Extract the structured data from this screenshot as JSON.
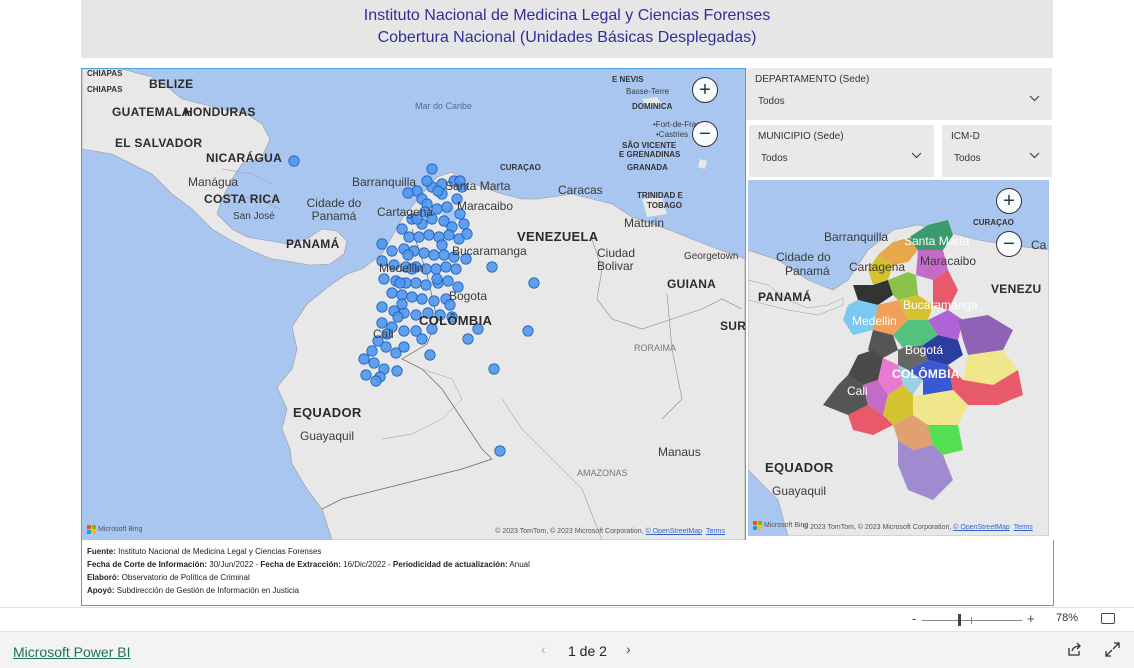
{
  "header": {
    "title_line1": "Instituto Nacional de Medicina Legal y Ciencias Forenses",
    "title_line2": "Cobertura Nacional (Unidades Básicas Desplegadas)"
  },
  "map_main": {
    "labels": {
      "belize": "BELIZE",
      "chiapas": "CHIAPAS",
      "guatemala": "GUATEMALA",
      "honduras": "HONDURAS",
      "el_salvador": "EL SALVADOR",
      "nicaragua": "NICARÁGUA",
      "managua": "Manágua",
      "costa_rica": "COSTA RICA",
      "san_jose": "San José",
      "panama_city": "Cidade do Panamá",
      "panama": "PANAMÁ",
      "mar_caribe": "Mar do Caribe",
      "nevis": "E NEVIS",
      "basse_terre": "Basse-Terre",
      "dominica": "DOMINICA",
      "fort_de_france": "•Fort-de-France",
      "castries": "•Castries",
      "san_vicente": "SÃO VICENTE",
      "granadinas": "E GRENADINAS",
      "granada": "GRANADA",
      "curacao": "CURAÇAO",
      "barranquilla": "Barranquilla",
      "santa_marta": "Santa Marta",
      "cartagena": "Cartagena",
      "maracaibo": "Maracaibo",
      "caracas": "Caracas",
      "trinidad": "TRINIDAD E",
      "tobago": "TOBAGO",
      "maturin": "Maturin",
      "venezuela": "VENEZUELA",
      "bucaramanga": "Bucaramanga",
      "ciudad_bolivar_1": "Ciudad",
      "ciudad_bolivar_2": "Bolivar",
      "georgetown": "Georgetown",
      "guiana": "GUIANA",
      "medellin": "Medellin",
      "bogota": "Bogota",
      "colombia": "COLÔMBIA",
      "sur": "SUR",
      "roraima": "RORAIMA",
      "cali": "Cali",
      "equador": "EQUADOR",
      "guayaquil": "Guayaquil",
      "manaus": "Manaus",
      "amazonas": "AMAZONAS"
    },
    "bing": "Microsoft Bing",
    "attribution_prefix": "© 2023 TomTom, © 2023 Microsoft Corporation, ",
    "osm": "© OpenStreetMap",
    "terms": "Terms",
    "zoom_in": "+",
    "zoom_out": "−"
  },
  "slicers": {
    "departamento": {
      "label": "DEPARTAMENTO (Sede)",
      "value": "Todos"
    },
    "municipio": {
      "label": "MUNICIPIO (Sede)",
      "value": "Todos"
    },
    "icm": {
      "label": "ICM-D",
      "value": "Todos"
    }
  },
  "map_dept": {
    "labels": {
      "curacao": "CURAÇAO",
      "barranquilla": "Barranquilla",
      "santa_marta": "Santa Marta",
      "ca": "Ca",
      "panama_city_1": "Cidade do",
      "panama_city_2": "Panamá",
      "cartagena": "Cartagena",
      "maracaibo": "Maracaibo",
      "panama": "PANAMÁ",
      "bucaramanga": "Bucaramanga",
      "venezu": "VENEZU",
      "medellin": "Medellin",
      "bogota": "Bogotá",
      "colombia": "COLÔMBIA",
      "cali": "Cali",
      "equador": "EQUADOR",
      "guayaquil": "Guayaquil"
    },
    "bing": "Microsoft Bing",
    "attribution_prefix": "© 2023 TomTom, © 2023 Microsoft Corporation, ",
    "osm": "© OpenStreetMap",
    "terms": "Terms",
    "zoom_in": "+",
    "zoom_out": "−"
  },
  "footnote": {
    "fuente_label": "Fuente:",
    "fuente_value": " Instituto Nacional de Medicina Legal y Ciencias Forenses",
    "corte_label": "Fecha de Corte de Información:",
    "corte_value": " 30/Jun/2022 - ",
    "extraccion_label": "Fecha de Extracción:",
    "extraccion_value": " 16/Dic/2022 - ",
    "periodicidad_label": "Periodicidad de actualización:",
    "periodicidad_value": " Anual",
    "elaboro_label": "Elaboró:",
    "elaboro_value": " Observatorio de Política de Criminal",
    "apoyo_label": "Apoyó:",
    "apoyo_value": " Subdirección de Gestión de Información en Justicia"
  },
  "zoom": {
    "minus": "-",
    "plus": "+",
    "percent": "78%"
  },
  "bottom": {
    "brand": "Microsoft Power BI",
    "page_indicator": "1 de 2",
    "prev": "‹",
    "next": "›"
  },
  "colors": {
    "accent": "#4aa3df",
    "title": "#2f2f9a",
    "dot_fill": "#4f97ee",
    "dot_stroke": "#1f5fbf",
    "sea": "#a9c6f0",
    "land": "#e8e8e8",
    "brand": "#1f6f5f"
  },
  "icons": {
    "share": "share-icon",
    "expand": "expand-icon",
    "fit": "fit-page-icon"
  }
}
